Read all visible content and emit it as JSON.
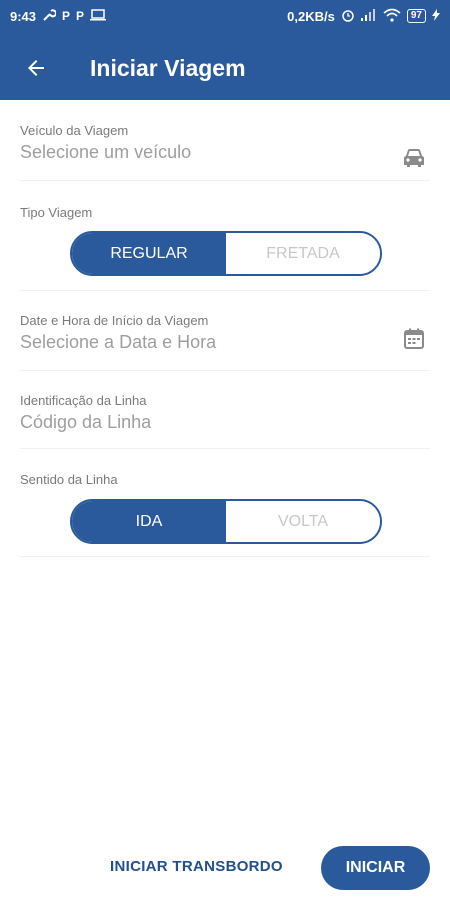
{
  "status_bar": {
    "time": "9:43",
    "net_speed": "0,2KB/s",
    "battery": "97"
  },
  "appbar": {
    "title": "Iniciar Viagem"
  },
  "form": {
    "vehicle": {
      "label": "Veículo da Viagem",
      "placeholder": "Selecione um veículo",
      "icon": "car-icon"
    },
    "trip_type": {
      "label": "Tipo Viagem",
      "options": [
        "REGULAR",
        "FRETADA"
      ],
      "selected": "REGULAR"
    },
    "start_datetime": {
      "label": "Date e Hora de Início da Viagem",
      "placeholder": "Selecione a Data e Hora",
      "icon": "calendar-icon"
    },
    "line_id": {
      "label": "Identificação da Linha",
      "placeholder": "Código da Linha"
    },
    "direction": {
      "label": "Sentido da Linha",
      "options": [
        "IDA",
        "VOLTA"
      ],
      "selected": "IDA"
    }
  },
  "footer": {
    "secondary_label": "INICIAR TRANSBORDO",
    "primary_label": "INICIAR"
  },
  "colors": {
    "primary": "#2a5a9b",
    "text_muted": "#9e9e9e"
  }
}
